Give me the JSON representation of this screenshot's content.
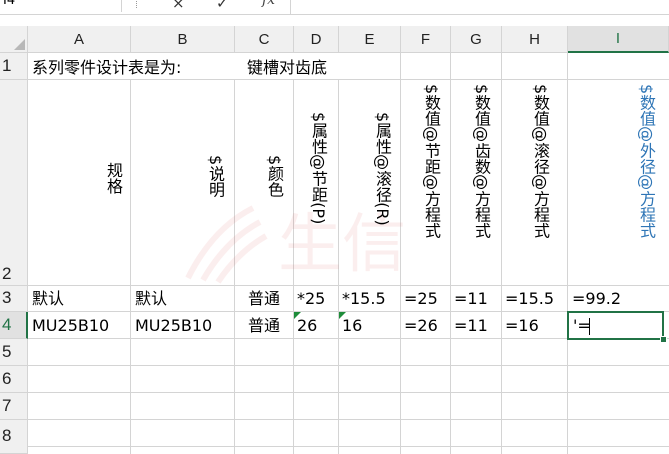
{
  "formula_bar": {
    "name_box": "I4",
    "cancel_icon": "×",
    "enter_icon": "✓",
    "fx_label": "fx"
  },
  "columns": [
    "A",
    "B",
    "C",
    "D",
    "E",
    "F",
    "G",
    "H",
    "I"
  ],
  "rows": [
    "1",
    "2",
    "3",
    "4",
    "5",
    "6",
    "7",
    "8"
  ],
  "cells": {
    "A1": "系列零件设计表是为:",
    "D1": "键槽对齿底",
    "A2": "规格",
    "B2": "$说明",
    "C2": "$颜色",
    "D2": "$属性@节距(P)",
    "E2": "$属性@滚径(R)",
    "F2": "$数值@节距@方程式",
    "G2": "$数值@齿数@方程式",
    "H2": "$数值@滚径@方程式",
    "I2": "$数值@外径@方程式",
    "A3": "默认",
    "B3": "默认",
    "C3": "普通",
    "D3": "*25",
    "E3": "*15.5",
    "F3": "=25",
    "G3": "=11",
    "H3": "=15.5",
    "I3": "=99.2",
    "A4": "MU25B10",
    "B4": "MU25B10",
    "C4": "普通",
    "D4": "26",
    "E4": "16",
    "F4": "=26",
    "G4": "=11",
    "H4": "=16",
    "I4": "'="
  },
  "watermark": "生信"
}
